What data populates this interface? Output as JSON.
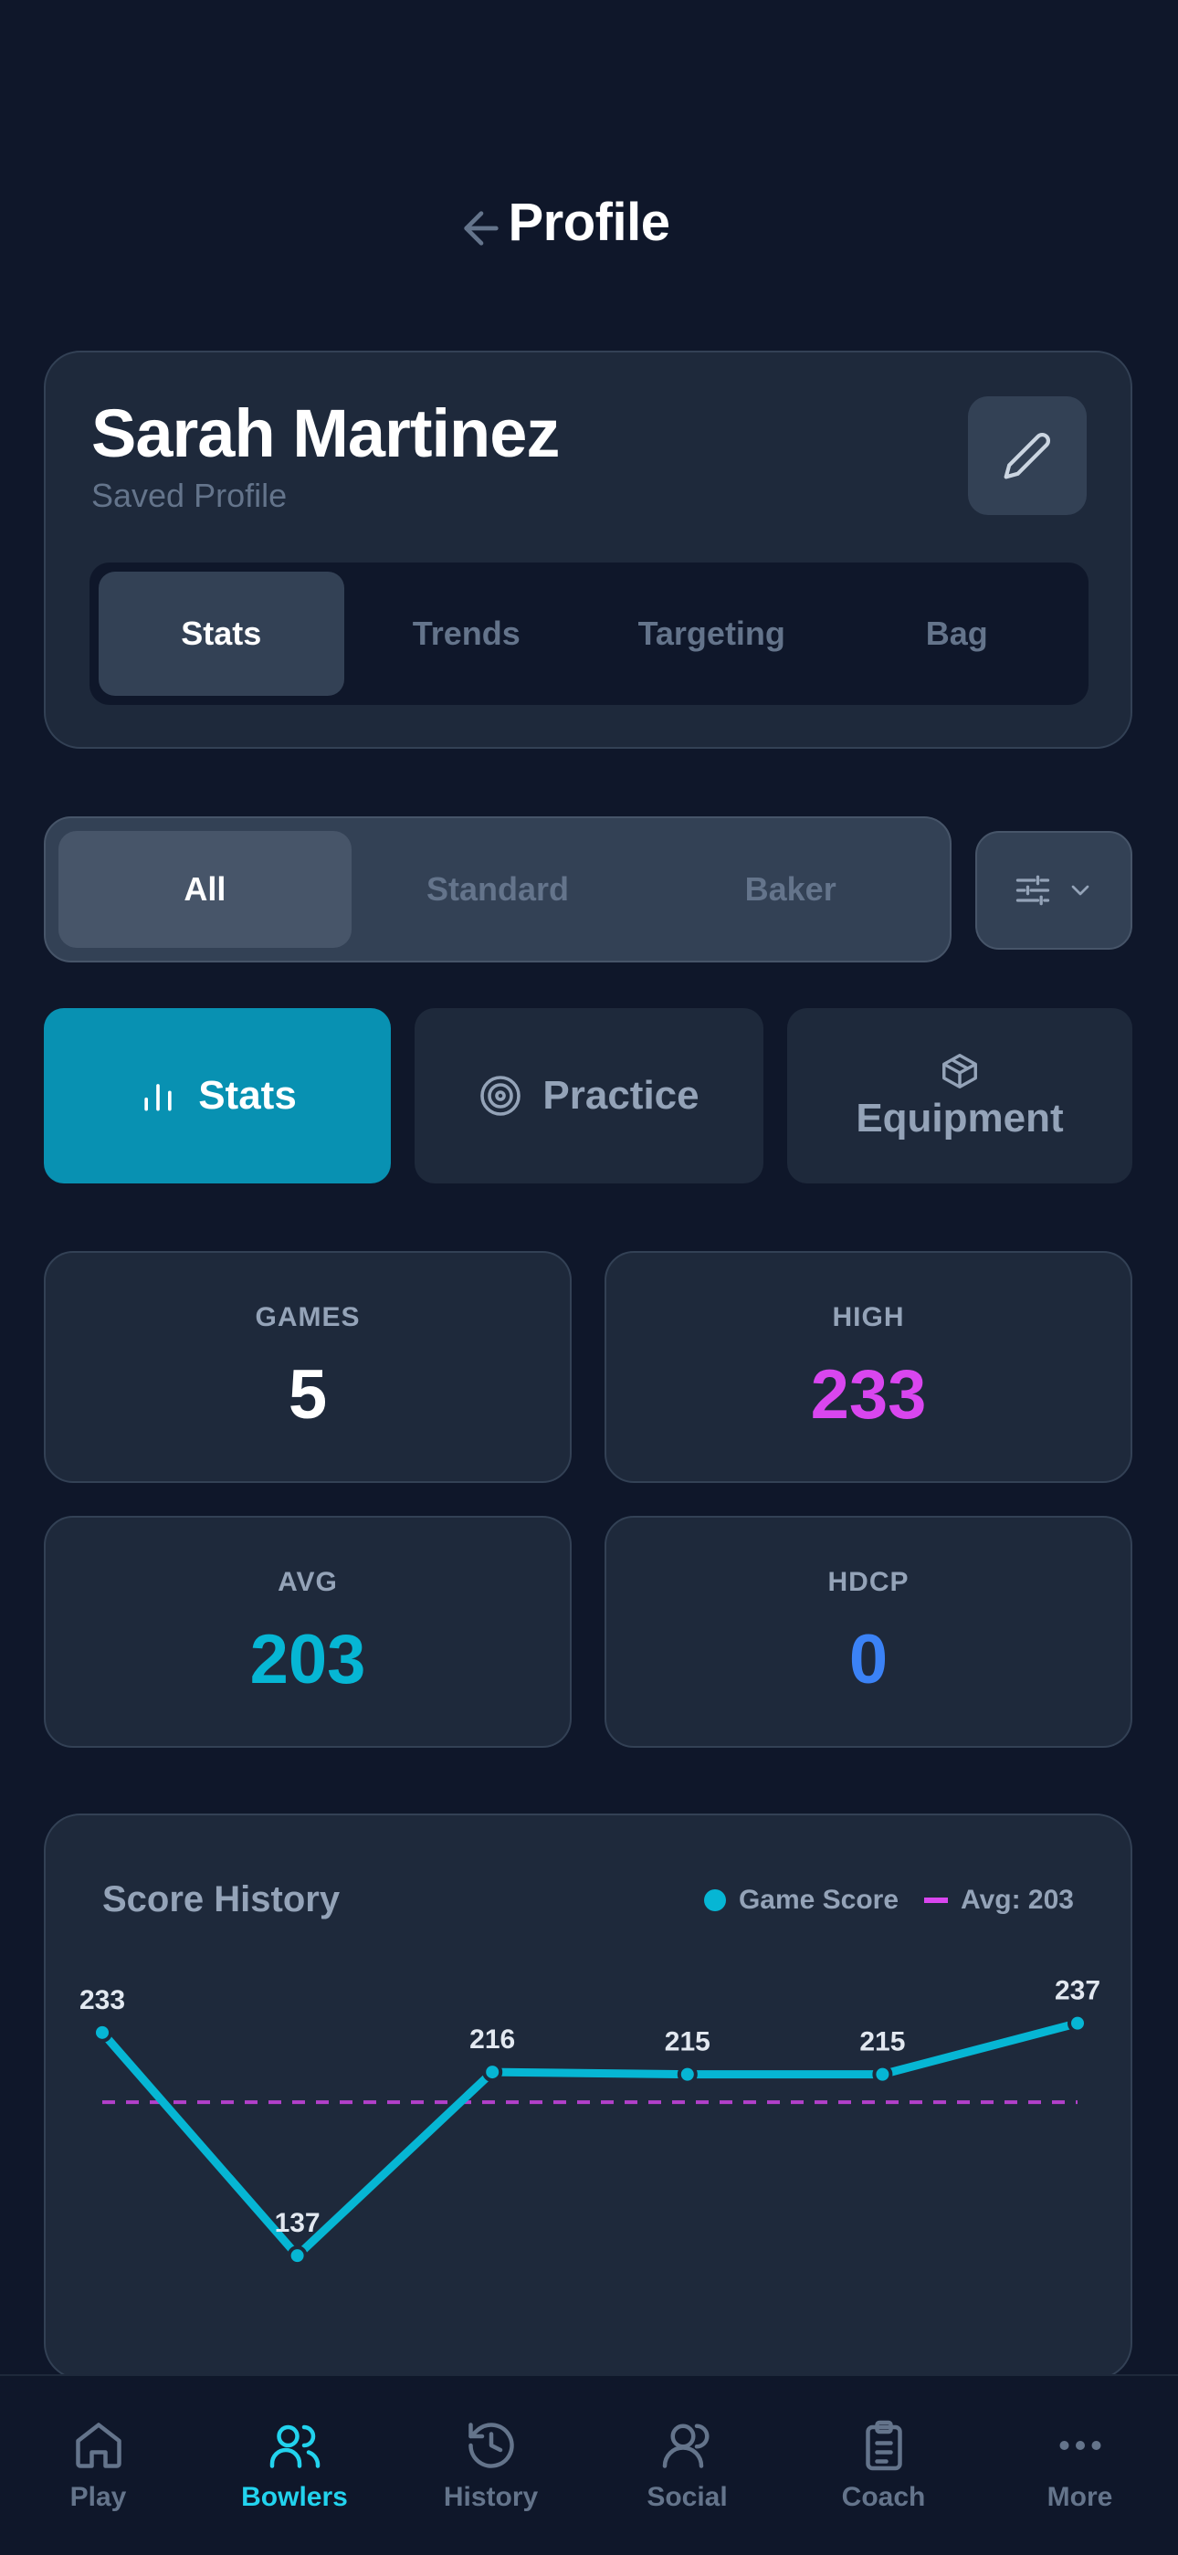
{
  "header": {
    "title": "Profile",
    "back_icon": "arrow-left-icon"
  },
  "profile": {
    "name": "Sarah Martinez",
    "subtitle": "Saved Profile",
    "tabs": [
      {
        "label": "Stats",
        "active": true
      },
      {
        "label": "Trends",
        "active": false
      },
      {
        "label": "Targeting",
        "active": false
      },
      {
        "label": "Bag",
        "active": false
      }
    ]
  },
  "game_filter": {
    "options": [
      {
        "label": "All",
        "active": true
      },
      {
        "label": "Standard",
        "active": false
      },
      {
        "label": "Baker",
        "active": false
      }
    ]
  },
  "modes": [
    {
      "label": "Stats",
      "icon": "bar-chart-icon",
      "active": true
    },
    {
      "label": "Practice",
      "icon": "target-icon",
      "active": false
    },
    {
      "label": "Equipment",
      "icon": "box-icon",
      "active": false
    }
  ],
  "stats": {
    "games": {
      "label": "GAMES",
      "value": "5",
      "color": "#ffffff"
    },
    "high": {
      "label": "HIGH",
      "value": "233",
      "color": "#d946ef"
    },
    "avg": {
      "label": "AVG",
      "value": "203",
      "color": "#06b6d4"
    },
    "hdcp": {
      "label": "HDCP",
      "value": "0",
      "color": "#3b82f6"
    }
  },
  "chart": {
    "title": "Score History",
    "legend_score": "Game Score",
    "legend_avg": "Avg: 203"
  },
  "chart_data": {
    "type": "line",
    "x": [
      1,
      2,
      3,
      4,
      5,
      6
    ],
    "series": [
      {
        "name": "Game Score",
        "values": [
          233,
          137,
          216,
          215,
          215,
          237
        ],
        "color": "#06b6d4"
      }
    ],
    "reference_line": {
      "name": "Avg: 203",
      "value": 203,
      "color": "#d946ef"
    },
    "ylim": [
      130,
      240
    ],
    "data_labels": true
  },
  "nav": [
    {
      "label": "Play",
      "icon": "home-icon",
      "active": false
    },
    {
      "label": "Bowlers",
      "icon": "users-icon",
      "active": true
    },
    {
      "label": "History",
      "icon": "history-icon",
      "active": false
    },
    {
      "label": "Social",
      "icon": "social-icon",
      "active": false
    },
    {
      "label": "Coach",
      "icon": "clipboard-icon",
      "active": false
    },
    {
      "label": "More",
      "icon": "more-icon",
      "active": false
    }
  ]
}
